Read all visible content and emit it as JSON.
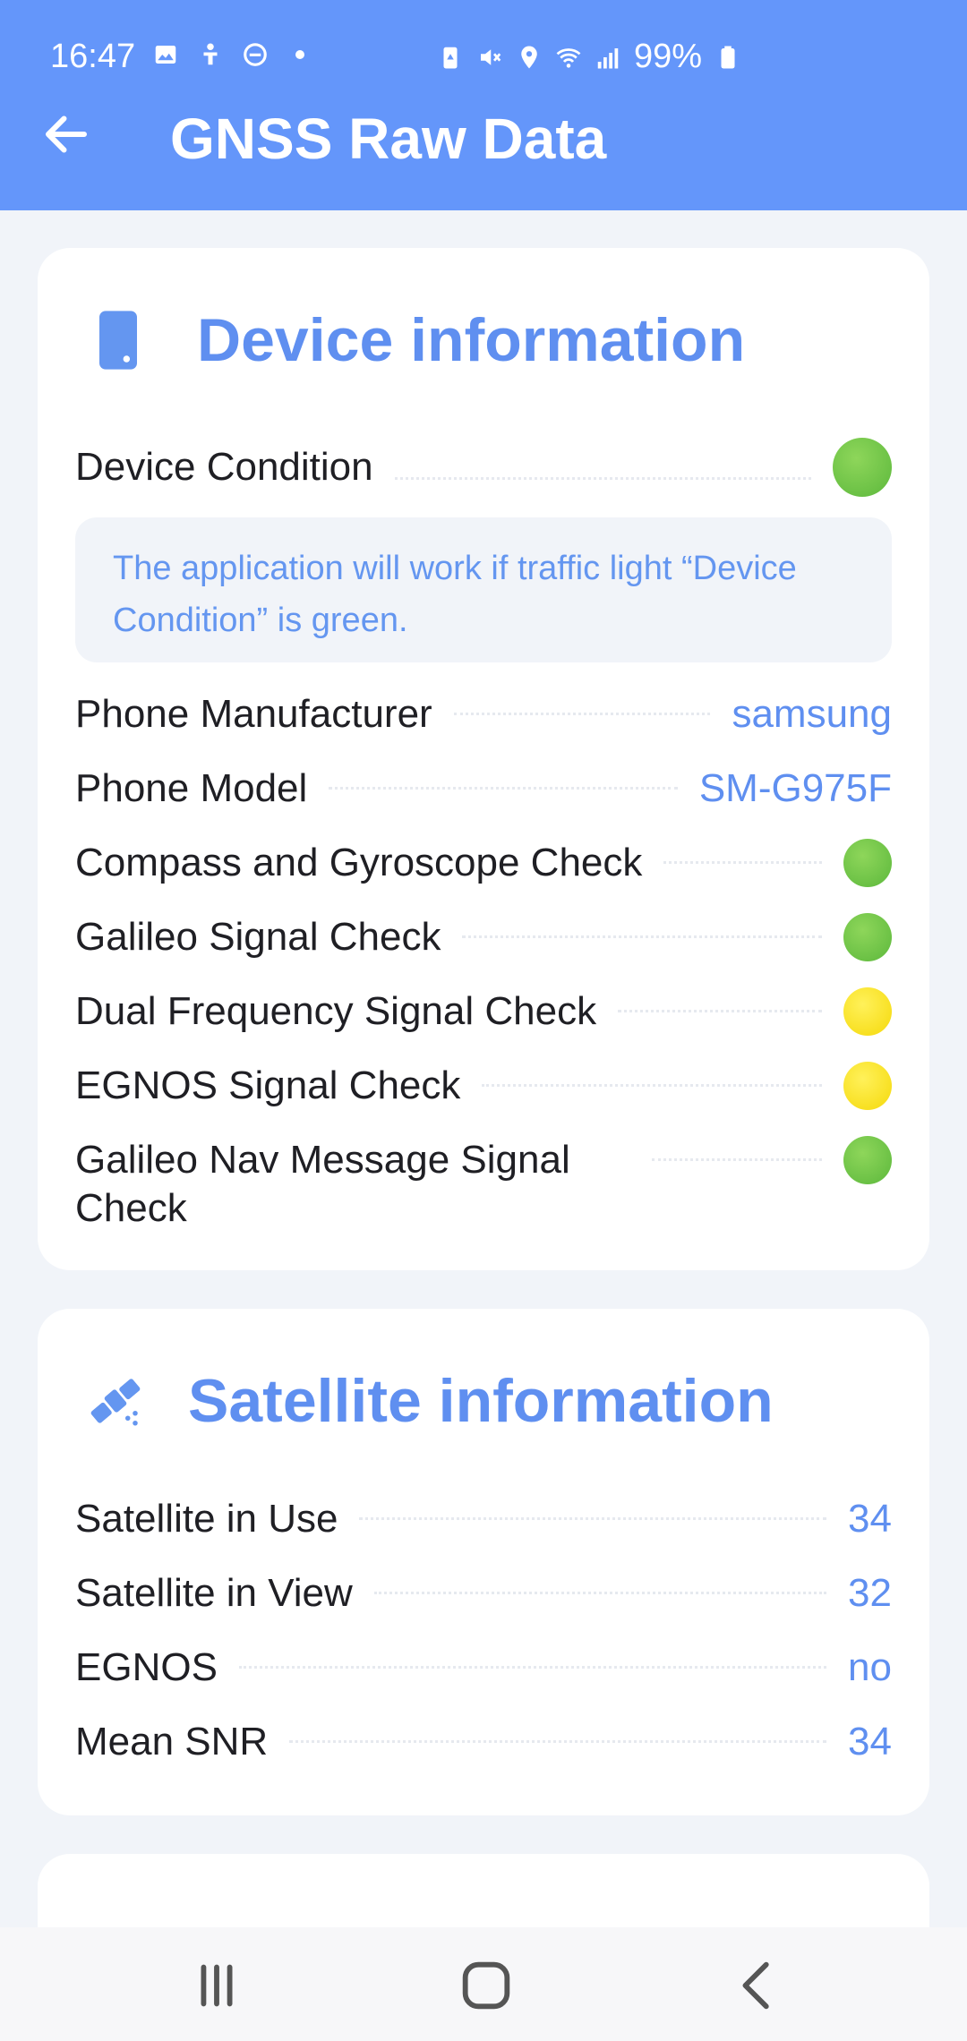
{
  "status_bar": {
    "time": "16:47",
    "battery": "99%",
    "left_icons": [
      "image-icon",
      "accessibility-icon",
      "dnd-icon",
      "dot-icon"
    ],
    "right_icons": [
      "battery-saver-icon",
      "mute-icon",
      "location-icon",
      "wifi-icon",
      "signal-icon",
      "battery-icon"
    ]
  },
  "app_bar": {
    "title": "GNSS Raw Data",
    "back_icon": "arrow-left-icon"
  },
  "colors": {
    "accent": "#5f8ff0",
    "appbar": "#6496fa",
    "green": "#5cb83c",
    "yellow": "#f5d90a"
  },
  "device_card": {
    "title": "Device information",
    "icon": "phone-icon",
    "condition_label": "Device Condition",
    "condition_status": "green",
    "notice": "The application will work if traffic light “Device Condition” is green.",
    "manufacturer_label": "Phone Manufacturer",
    "manufacturer_value": "samsung",
    "model_label": "Phone Model",
    "model_value": "SM-G975F",
    "checks": [
      {
        "label": "Compass and Gyroscope Check",
        "status": "green"
      },
      {
        "label": "Galileo Signal Check",
        "status": "green"
      },
      {
        "label": "Dual Frequency Signal Check",
        "status": "yellow"
      },
      {
        "label": "EGNOS Signal Check",
        "status": "yellow"
      },
      {
        "label": "Galileo Nav Message Signal Check",
        "status": "green"
      }
    ]
  },
  "satellite_card": {
    "title": "Satellite information",
    "icon": "satellite-icon",
    "rows": [
      {
        "label": "Satellite in Use",
        "value": "34"
      },
      {
        "label": "Satellite in View",
        "value": "32"
      },
      {
        "label": "EGNOS",
        "value": "no"
      },
      {
        "label": "Mean SNR",
        "value": "34"
      }
    ]
  },
  "nav_bar": {
    "buttons": [
      "recents-icon",
      "home-icon",
      "back-icon"
    ]
  }
}
